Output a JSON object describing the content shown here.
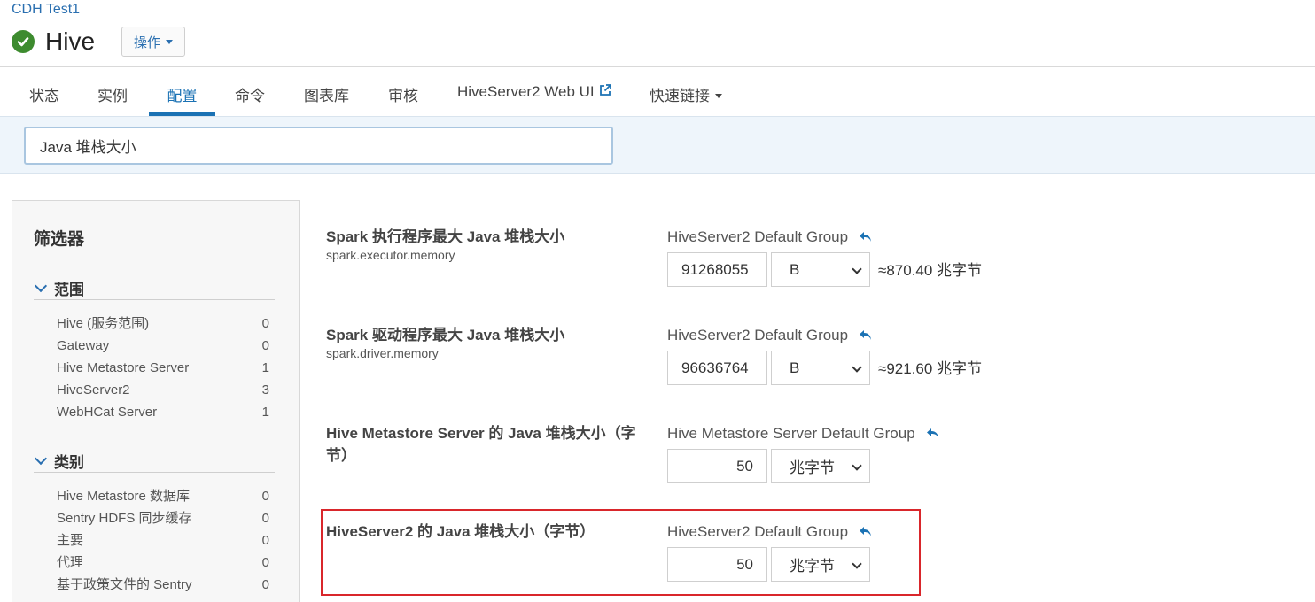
{
  "header": {
    "cluster_name": "CDH Test1",
    "service_name": "Hive",
    "service_status": "good",
    "actions_label": "操作"
  },
  "tabs": [
    {
      "label": "状态",
      "active": false
    },
    {
      "label": "实例",
      "active": false
    },
    {
      "label": "配置",
      "active": true
    },
    {
      "label": "命令",
      "active": false
    },
    {
      "label": "图表库",
      "active": false
    },
    {
      "label": "审核",
      "active": false
    },
    {
      "label": "HiveServer2 Web UI",
      "active": false,
      "icon": "external-link-icon"
    },
    {
      "label": "快速链接",
      "active": false,
      "icon": "caret-down-icon"
    }
  ],
  "search": {
    "value": "Java 堆栈大小"
  },
  "filters": {
    "title": "筛选器",
    "sections": [
      {
        "title": "范围",
        "items": [
          {
            "label": "Hive (服务范围)",
            "count": "0"
          },
          {
            "label": "Gateway",
            "count": "0"
          },
          {
            "label": "Hive Metastore Server",
            "count": "1"
          },
          {
            "label": "HiveServer2",
            "count": "3"
          },
          {
            "label": "WebHCat Server",
            "count": "1"
          }
        ]
      },
      {
        "title": "类别",
        "items": [
          {
            "label": "Hive Metastore 数据库",
            "count": "0"
          },
          {
            "label": "Sentry HDFS 同步缓存",
            "count": "0"
          },
          {
            "label": "主要",
            "count": "0"
          },
          {
            "label": "代理",
            "count": "0"
          },
          {
            "label": "基于政策文件的 Sentry",
            "count": "0"
          }
        ]
      }
    ]
  },
  "properties": [
    {
      "name": "Spark 执行程序最大 Java 堆栈大小",
      "key": "spark.executor.memory",
      "group": "HiveServer2 Default Group",
      "value": "91268055",
      "unit": "B",
      "approx": "≈870.40 兆字节"
    },
    {
      "name": "Spark 驱动程序最大 Java 堆栈大小",
      "key": "spark.driver.memory",
      "group": "HiveServer2 Default Group",
      "value": "96636764",
      "unit": "B",
      "approx": "≈921.60 兆字节"
    },
    {
      "name": "Hive Metastore Server 的 Java 堆栈大小（字节）",
      "key": "",
      "group": "Hive Metastore Server Default Group",
      "value": "50",
      "unit": "兆字节",
      "approx": ""
    },
    {
      "name": "HiveServer2 的 Java 堆栈大小（字节）",
      "key": "",
      "group": "HiveServer2 Default Group",
      "value": "50",
      "unit": "兆字节",
      "approx": "",
      "highlighted": true
    }
  ],
  "colors": {
    "accent": "#1b72b4",
    "link": "#2a6fb0",
    "status_good": "#3d8b2f",
    "highlight": "#d9262b"
  }
}
